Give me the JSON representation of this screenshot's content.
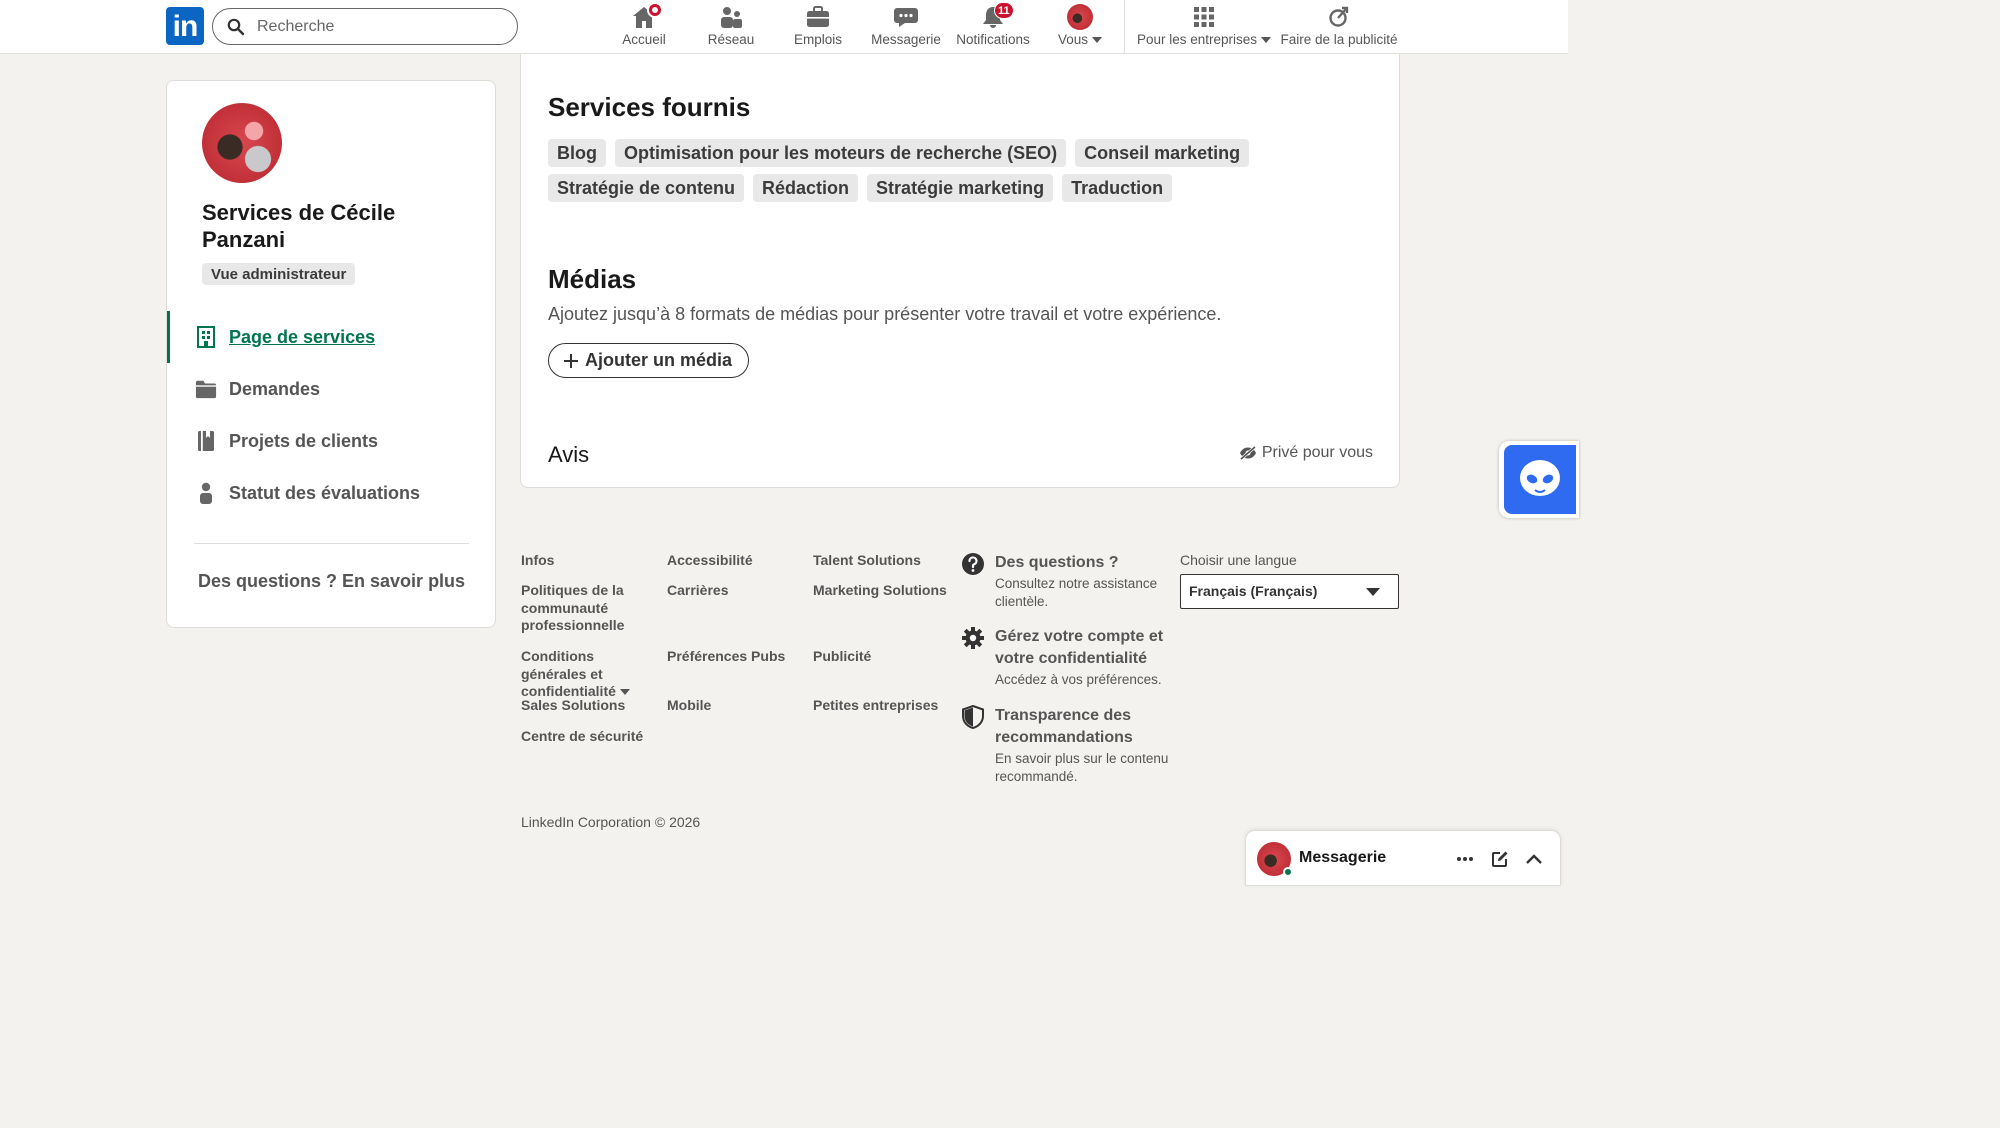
{
  "brand": {
    "logo_text": "in",
    "accent": "#0a66c2",
    "active_green": "#01754f",
    "badge_red": "#cb112d"
  },
  "search": {
    "placeholder": "Recherche"
  },
  "nav": {
    "home": "Accueil",
    "network": "Réseau",
    "jobs": "Emplois",
    "messaging": "Messagerie",
    "notifications": "Notifications",
    "notifications_count": "11",
    "me": "Vous",
    "business": "Pour les entreprises",
    "advertise": "Faire de la publicité"
  },
  "sidebar": {
    "title": "Services de Cécile Panzani",
    "badge": "Vue administrateur",
    "items": [
      {
        "label": "Page de services",
        "icon": "building-icon",
        "active": true
      },
      {
        "label": "Demandes",
        "icon": "folder-icon"
      },
      {
        "label": "Projets de clients",
        "icon": "notebook-icon"
      },
      {
        "label": "Statut des évaluations",
        "icon": "person-icon"
      }
    ],
    "help_link": "Des questions ? En savoir plus"
  },
  "main": {
    "services_heading": "Services fournis",
    "services": [
      "Blog",
      "Optimisation pour les moteurs de recherche (SEO)",
      "Conseil marketing",
      "Stratégie de contenu",
      "Rédaction",
      "Stratégie marketing",
      "Traduction"
    ],
    "media_heading": "Médias",
    "media_description": "Ajoutez jusqu’à 8 formats de médias pour présenter votre travail et votre expérience.",
    "add_media_button": "Ajouter un média",
    "reviews_heading": "Avis",
    "private_label": "Privé pour vous"
  },
  "footer": {
    "links": {
      "infos": "Infos",
      "accessibility": "Accessibilité",
      "talent": "Talent Solutions",
      "community": "Politiques de la communauté professionnelle",
      "careers": "Carrières",
      "marketing": "Marketing Solutions",
      "privacy": "Conditions générales et confidentialité",
      "ad_prefs": "Préférences Pubs",
      "advertising": "Publicité",
      "sales": "Sales Solutions",
      "mobile": "Mobile",
      "small_business": "Petites entreprises",
      "safety": "Centre de sécurité"
    },
    "help": [
      {
        "title": "Des questions ?",
        "subtitle": "Consultez notre assistance clientèle.",
        "icon": "question-icon"
      },
      {
        "title": "Gérez votre compte et votre confidentialité",
        "subtitle": "Accédez à vos préférences.",
        "icon": "gear-icon"
      },
      {
        "title": "Transparence des recommandations",
        "subtitle": "En savoir plus sur le contenu recommandé.",
        "icon": "shield-icon"
      }
    ],
    "language_label": "Choisir une langue",
    "language_value": "Français (Français)",
    "copyright": "LinkedIn Corporation © 2026"
  },
  "messaging_bar": {
    "title": "Messagerie"
  }
}
